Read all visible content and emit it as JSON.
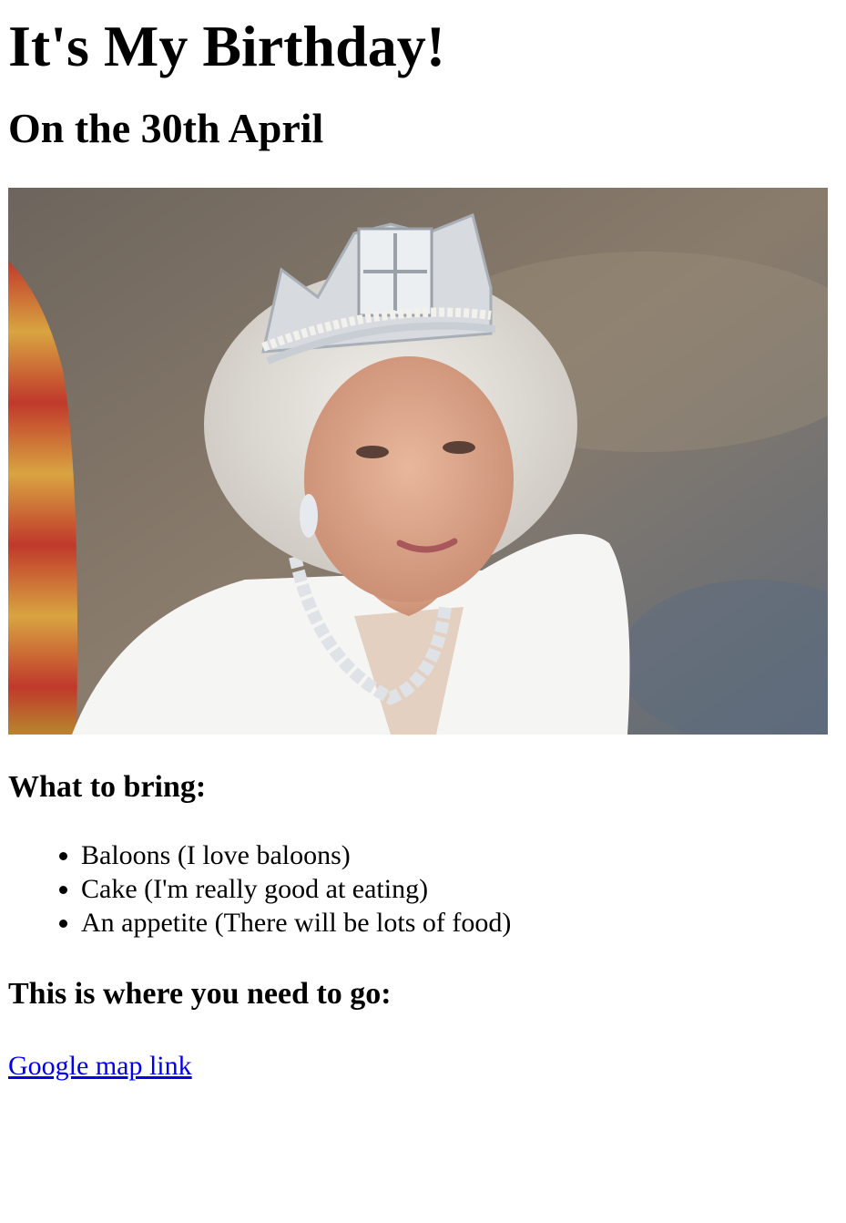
{
  "page": {
    "title": "It's My Birthday!",
    "subtitle": "On the 30th April",
    "bring_heading": "What to bring:",
    "bring_items": [
      "Baloons (I love baloons)",
      "Cake (I'm really good at eating)",
      "An appetite (There will be lots of food)"
    ],
    "location_heading": "This is where you need to go:",
    "map_link_label": "Google map link"
  },
  "photo": {
    "subject": "portrait-woman-with-tiara"
  },
  "colors": {
    "link": "#0000ee",
    "text": "#000000",
    "background": "#ffffff"
  }
}
